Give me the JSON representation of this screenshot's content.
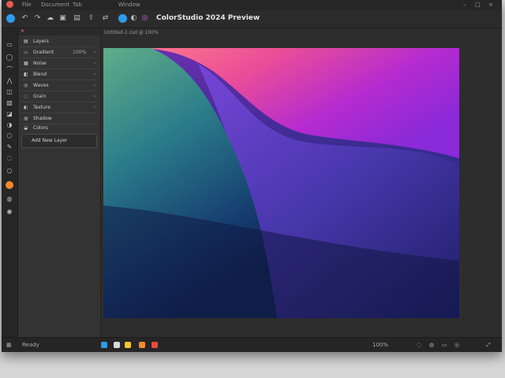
{
  "menubar": {
    "items": [
      "File",
      "Document",
      "Tab",
      "Window"
    ],
    "window_controls": [
      "–",
      "□",
      "×"
    ]
  },
  "toolbar": {
    "doc_title": "ColorStudio 2024 Preview",
    "icons": [
      "globe-icon",
      "undo-icon",
      "redo-icon",
      "cloud-icon",
      "image-icon",
      "folder-icon",
      "export-icon",
      "share-icon",
      "app-icon",
      "color-icon",
      "settings-icon"
    ]
  },
  "panel": {
    "title": "Layers",
    "rows": [
      {
        "icon": "layer-icon",
        "label": "Gradient",
        "value": "100%"
      },
      {
        "icon": "layer-icon",
        "label": "Noise",
        "value": ""
      },
      {
        "icon": "layer-icon",
        "label": "Blend",
        "value": ""
      },
      {
        "icon": "layer-icon",
        "label": "Waves",
        "value": ""
      },
      {
        "icon": "layer-icon",
        "label": "Grain",
        "value": ""
      },
      {
        "icon": "layer-icon",
        "label": "Texture",
        "value": ""
      },
      {
        "icon": "layer-icon",
        "label": "Shadow",
        "value": ""
      },
      {
        "icon": "layer-icon",
        "label": "Colors",
        "value": ""
      }
    ],
    "button_label": "Add New Layer"
  },
  "canvas": {
    "tabs_label": "Untitled-1.csd @ 100%"
  },
  "status": {
    "left_text": "Ready",
    "zoom": "100%",
    "colors": {
      "accent": "#2f9be8",
      "orange": "#f08a2b",
      "yellow": "#f5c52a",
      "red": "#e84b3c"
    }
  }
}
